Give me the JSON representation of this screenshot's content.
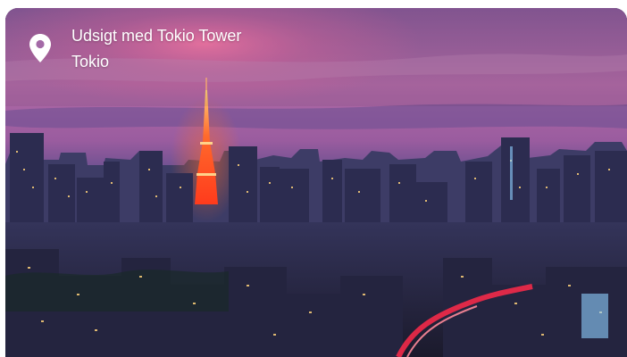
{
  "location": {
    "title": "Udsigt med Tokio Tower",
    "city": "Tokio"
  },
  "photo": {
    "subject": "Tokyo skyline at dusk with illuminated Tokyo Tower",
    "icon": "map-pin-icon"
  },
  "colors": {
    "sky_top": "#8f5b98",
    "sky_glow": "#e46aa0",
    "haze": "#5b4f8e",
    "tower": "#ff5a2a",
    "city_dark": "#232341",
    "lights": "#ffd27a",
    "text": "#ffffff"
  }
}
